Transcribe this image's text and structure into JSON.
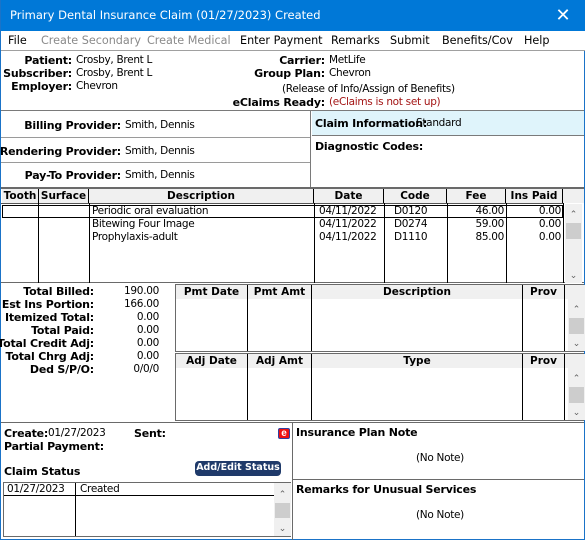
{
  "window": {
    "title": "Primary Dental Insurance Claim (01/27/2023) Created",
    "close_glyph": "✕"
  },
  "menu": {
    "items": [
      {
        "label": "File",
        "enabled": true
      },
      {
        "label": "Create Secondary",
        "enabled": false
      },
      {
        "label": "Create Medical",
        "enabled": false
      },
      {
        "label": "Enter Payment",
        "enabled": true
      },
      {
        "label": "Remarks",
        "enabled": true
      },
      {
        "label": "Submit",
        "enabled": true
      },
      {
        "label": "Benefits/Cov",
        "enabled": true
      },
      {
        "label": "Help",
        "enabled": true
      }
    ]
  },
  "header": {
    "patient_label": "Patient:",
    "patient": "Crosby, Brent L",
    "subscriber_label": "Subscriber:",
    "subscriber": "Crosby, Brent L",
    "employer_label": "Employer:",
    "employer": "Chevron",
    "carrier_label": "Carrier:",
    "carrier": "MetLife",
    "group_plan_label": "Group Plan:",
    "group_plan": "Chevron",
    "release_note": "(Release of Info/Assign of Benefits)",
    "eclaims_label": "eClaims Ready:",
    "eclaims_value": "(eClaims is not set up)",
    "eclaims_color": "#a31414"
  },
  "providers": {
    "billing_label": "Billing Provider:",
    "billing": "Smith, Dennis",
    "rendering_label": "Rendering Provider:",
    "rendering": "Smith, Dennis",
    "payto_label": "Pay-To Provider:",
    "payto": "Smith, Dennis"
  },
  "claim_info": {
    "label": "Claim Information:",
    "value": "Standard",
    "bg_color": "#dff4fb",
    "diagnostic_label": "Diagnostic Codes:"
  },
  "procedures": {
    "columns": [
      "Tooth",
      "Surface",
      "Description",
      "Date",
      "Code",
      "Fee",
      "Ins Paid"
    ],
    "rows": [
      {
        "tooth": "",
        "surface": "",
        "description": "Periodic oral evaluation",
        "date": "04/11/2022",
        "code": "D0120",
        "fee": "46.00",
        "ins_paid": "0.00"
      },
      {
        "tooth": "",
        "surface": "",
        "description": "Bitewing Four Image",
        "date": "04/11/2022",
        "code": "D0274",
        "fee": "59.00",
        "ins_paid": "0.00"
      },
      {
        "tooth": "",
        "surface": "",
        "description": "Prophylaxis-adult",
        "date": "04/11/2022",
        "code": "D1110",
        "fee": "85.00",
        "ins_paid": "0.00"
      }
    ]
  },
  "totals": [
    {
      "label": "Total Billed:",
      "value": "190.00"
    },
    {
      "label": "Est Ins Portion:",
      "value": "166.00"
    },
    {
      "label": "Itemized Total:",
      "value": "0.00"
    },
    {
      "label": "Total Paid:",
      "value": "0.00"
    },
    {
      "label": "Total Credit Adj:",
      "value": "0.00"
    },
    {
      "label": "Total Chrg Adj:",
      "value": "0.00"
    },
    {
      "label": "Ded S/P/O:",
      "value": "0/0/0"
    }
  ],
  "payments": {
    "columns": [
      "Pmt Date",
      "Pmt Amt",
      "Description",
      "Prov"
    ],
    "rows": []
  },
  "adjustments": {
    "columns": [
      "Adj Date",
      "Adj Amt",
      "Type",
      "Prov"
    ],
    "rows": []
  },
  "status": {
    "create_label": "Create:",
    "create_date": "01/27/2023",
    "sent_label": "Sent:",
    "sent_value": "",
    "partial_payment_label": "Partial Payment:",
    "claim_status_label": "Claim Status",
    "add_edit_button": "Add/Edit Status",
    "button_color": "#1f3a6a",
    "eclaims_icon_glyph": "e",
    "rows": [
      {
        "date": "01/27/2023",
        "status": "Created"
      }
    ]
  },
  "notes": {
    "insurance_plan_label": "Insurance Plan Note",
    "insurance_plan_value": "(No Note)",
    "remarks_label": "Remarks for Unusual Services",
    "remarks_value": "(No Note)"
  },
  "scroll_glyphs": {
    "up": "⌃",
    "down": "⌄"
  }
}
